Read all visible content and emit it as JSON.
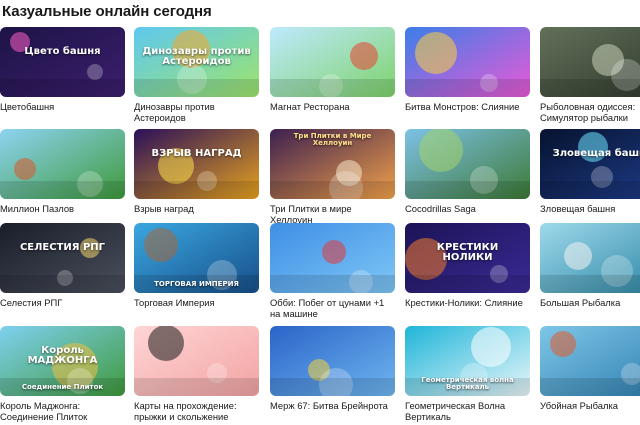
{
  "section": {
    "title": "Казуальные онлайн сегодня"
  },
  "games": [
    {
      "title": "Цветобашня",
      "art": "Цвето башня",
      "art_top": "",
      "art_bottom": "",
      "bg": [
        "#1d1346",
        "#3c1f6e"
      ],
      "accent": "#ff5fc4"
    },
    {
      "title": "Динозавры против Астероидов",
      "art": "Динозавры против Астероидов",
      "art_top": "",
      "art_bottom": "",
      "bg": [
        "#5ec8f0",
        "#9ee46b"
      ],
      "accent": "#f7a62b"
    },
    {
      "title": "Магнат Ресторана",
      "art": "",
      "art_top": "",
      "art_bottom": "",
      "bg": [
        "#bfe9ff",
        "#7dd36b"
      ],
      "accent": "#e8432f"
    },
    {
      "title": "Битва Монстров: Слияние",
      "art": "",
      "art_top": "",
      "art_bottom": "",
      "bg": [
        "#3b7ee8",
        "#e95ad6"
      ],
      "accent": "#ffd23f"
    },
    {
      "title": "Рыболовная одиссея: Симулятор рыбалки",
      "art": "",
      "art_top": "",
      "art_bottom": "",
      "bg": [
        "#62705a",
        "#2f3a2c"
      ],
      "accent": "#c9d1b8"
    },
    {
      "title": "Миллион Пазлов",
      "art": "",
      "art_top": "",
      "art_bottom": "",
      "bg": [
        "#8ed3f2",
        "#3e9a3b"
      ],
      "accent": "#d9572a"
    },
    {
      "title": "Взрыв наград",
      "art": "ВЗРЫВ НАГРАД",
      "art_top": "",
      "art_bottom": "",
      "bg": [
        "#2a0f59",
        "#e6a21f"
      ],
      "accent": "#ffe24a"
    },
    {
      "title": "Три Плитки в мире Хеллоуин",
      "art": "",
      "art_top": "Три Плитки в Мире Хеллоуин",
      "art_bottom": "",
      "bg": [
        "#3b1f4e",
        "#f2a14b"
      ],
      "accent": "#f6e7c8"
    },
    {
      "title": "Cocodrillas Saga",
      "art": "",
      "art_top": "",
      "art_bottom": "",
      "bg": [
        "#7dc1e6",
        "#3d7a36"
      ],
      "accent": "#a5d36b"
    },
    {
      "title": "Зловещая башня",
      "art": "Зловещая башня",
      "art_top": "",
      "art_bottom": "",
      "bg": [
        "#06122e",
        "#1e3c8a"
      ],
      "accent": "#6fe4ff"
    },
    {
      "title": "Селестия РПГ",
      "art": "СЕЛЕСТИЯ РПГ",
      "art_top": "",
      "art_bottom": "",
      "bg": [
        "#1a1e2b",
        "#4a4f5c"
      ],
      "accent": "#f2d36b"
    },
    {
      "title": "Торговая Империя",
      "art": "",
      "art_top": "",
      "art_bottom": "ТОРГОВАЯ ИМПЕРИЯ",
      "bg": [
        "#3aa7e0",
        "#174f8a"
      ],
      "accent": "#a5673a"
    },
    {
      "title": "Обби: Побег от цунами +1 на машине",
      "art": "",
      "art_top": "",
      "art_bottom": "",
      "bg": [
        "#3e8fe6",
        "#7fc6f5"
      ],
      "accent": "#e03a3a"
    },
    {
      "title": "Крестики-Нолики: Слияние",
      "art": "КРЕСТИКИ НОЛИКИ",
      "art_top": "",
      "art_bottom": "",
      "bg": [
        "#1b1356",
        "#3a2a95"
      ],
      "accent": "#f57c2a"
    },
    {
      "title": "Большая Рыбалка",
      "art": "",
      "art_top": "",
      "art_bottom": "",
      "bg": [
        "#9fd9ec",
        "#2b86a3"
      ],
      "accent": "#f2f2f2"
    },
    {
      "title": "Король Маджонга: Соединение Плиток",
      "art": "Король МАДЖОНГА",
      "art_top": "",
      "art_bottom": "Соединение Плиток",
      "bg": [
        "#7fd0f0",
        "#3f9a3c"
      ],
      "accent": "#f0c040"
    },
    {
      "title": "Карты на прохождение: прыжки и скольжение",
      "art": "",
      "art_top": "",
      "art_bottom": "",
      "bg": [
        "#ffd5d5",
        "#f2a3a3"
      ],
      "accent": "#1a1a1a"
    },
    {
      "title": "Мерж 67: Битва Брейнрота",
      "art": "",
      "art_top": "",
      "art_bottom": "",
      "bg": [
        "#2b64c8",
        "#6fb6f0"
      ],
      "accent": "#f4d23a"
    },
    {
      "title": "Геометрическая Волна Вертикаль",
      "art": "",
      "art_top": "",
      "art_bottom": "Геометрическая волна Вертикаль",
      "bg": [
        "#1fb5d8",
        "#e9f7fb"
      ],
      "accent": "#ffffff"
    },
    {
      "title": "Убойная Рыбалка",
      "art": "",
      "art_top": "",
      "art_bottom": "",
      "bg": [
        "#7ec6e8",
        "#2f7fb0"
      ],
      "accent": "#e25b2a"
    }
  ]
}
